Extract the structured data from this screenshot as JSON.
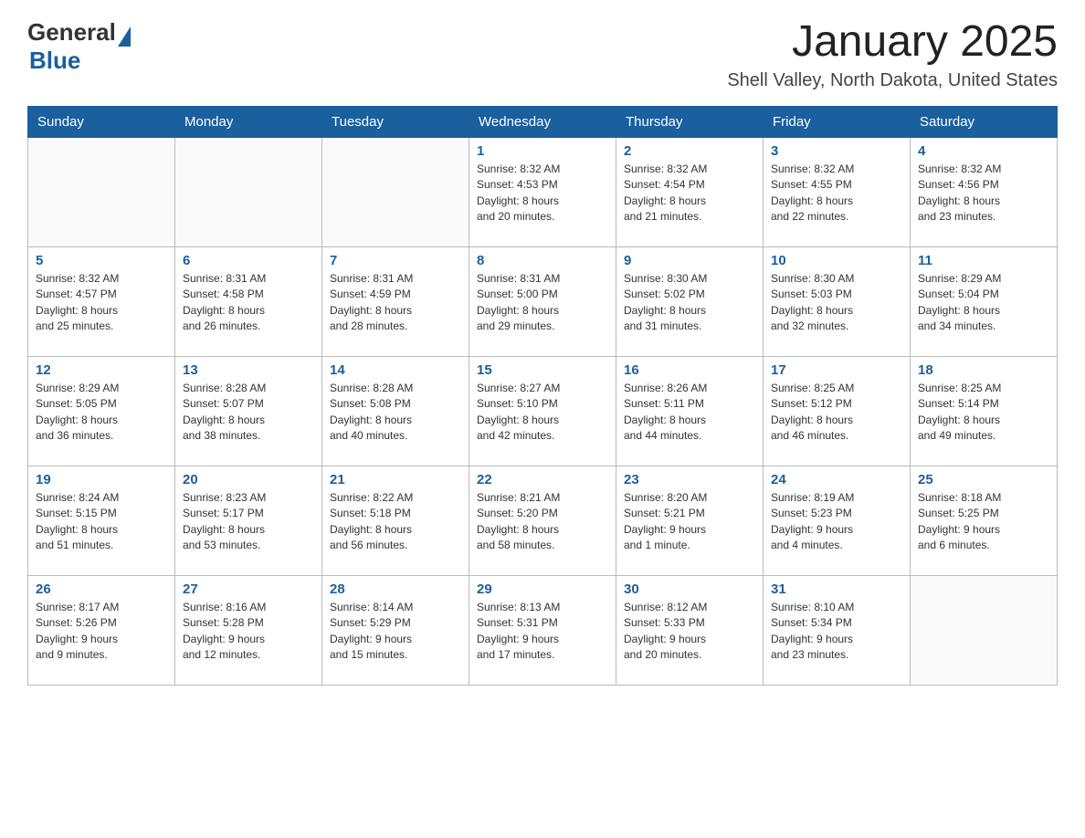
{
  "header": {
    "logo_general": "General",
    "logo_blue": "Blue",
    "month_title": "January 2025",
    "location": "Shell Valley, North Dakota, United States"
  },
  "days_of_week": [
    "Sunday",
    "Monday",
    "Tuesday",
    "Wednesday",
    "Thursday",
    "Friday",
    "Saturday"
  ],
  "weeks": [
    [
      {
        "num": "",
        "info": ""
      },
      {
        "num": "",
        "info": ""
      },
      {
        "num": "",
        "info": ""
      },
      {
        "num": "1",
        "info": "Sunrise: 8:32 AM\nSunset: 4:53 PM\nDaylight: 8 hours\nand 20 minutes."
      },
      {
        "num": "2",
        "info": "Sunrise: 8:32 AM\nSunset: 4:54 PM\nDaylight: 8 hours\nand 21 minutes."
      },
      {
        "num": "3",
        "info": "Sunrise: 8:32 AM\nSunset: 4:55 PM\nDaylight: 8 hours\nand 22 minutes."
      },
      {
        "num": "4",
        "info": "Sunrise: 8:32 AM\nSunset: 4:56 PM\nDaylight: 8 hours\nand 23 minutes."
      }
    ],
    [
      {
        "num": "5",
        "info": "Sunrise: 8:32 AM\nSunset: 4:57 PM\nDaylight: 8 hours\nand 25 minutes."
      },
      {
        "num": "6",
        "info": "Sunrise: 8:31 AM\nSunset: 4:58 PM\nDaylight: 8 hours\nand 26 minutes."
      },
      {
        "num": "7",
        "info": "Sunrise: 8:31 AM\nSunset: 4:59 PM\nDaylight: 8 hours\nand 28 minutes."
      },
      {
        "num": "8",
        "info": "Sunrise: 8:31 AM\nSunset: 5:00 PM\nDaylight: 8 hours\nand 29 minutes."
      },
      {
        "num": "9",
        "info": "Sunrise: 8:30 AM\nSunset: 5:02 PM\nDaylight: 8 hours\nand 31 minutes."
      },
      {
        "num": "10",
        "info": "Sunrise: 8:30 AM\nSunset: 5:03 PM\nDaylight: 8 hours\nand 32 minutes."
      },
      {
        "num": "11",
        "info": "Sunrise: 8:29 AM\nSunset: 5:04 PM\nDaylight: 8 hours\nand 34 minutes."
      }
    ],
    [
      {
        "num": "12",
        "info": "Sunrise: 8:29 AM\nSunset: 5:05 PM\nDaylight: 8 hours\nand 36 minutes."
      },
      {
        "num": "13",
        "info": "Sunrise: 8:28 AM\nSunset: 5:07 PM\nDaylight: 8 hours\nand 38 minutes."
      },
      {
        "num": "14",
        "info": "Sunrise: 8:28 AM\nSunset: 5:08 PM\nDaylight: 8 hours\nand 40 minutes."
      },
      {
        "num": "15",
        "info": "Sunrise: 8:27 AM\nSunset: 5:10 PM\nDaylight: 8 hours\nand 42 minutes."
      },
      {
        "num": "16",
        "info": "Sunrise: 8:26 AM\nSunset: 5:11 PM\nDaylight: 8 hours\nand 44 minutes."
      },
      {
        "num": "17",
        "info": "Sunrise: 8:25 AM\nSunset: 5:12 PM\nDaylight: 8 hours\nand 46 minutes."
      },
      {
        "num": "18",
        "info": "Sunrise: 8:25 AM\nSunset: 5:14 PM\nDaylight: 8 hours\nand 49 minutes."
      }
    ],
    [
      {
        "num": "19",
        "info": "Sunrise: 8:24 AM\nSunset: 5:15 PM\nDaylight: 8 hours\nand 51 minutes."
      },
      {
        "num": "20",
        "info": "Sunrise: 8:23 AM\nSunset: 5:17 PM\nDaylight: 8 hours\nand 53 minutes."
      },
      {
        "num": "21",
        "info": "Sunrise: 8:22 AM\nSunset: 5:18 PM\nDaylight: 8 hours\nand 56 minutes."
      },
      {
        "num": "22",
        "info": "Sunrise: 8:21 AM\nSunset: 5:20 PM\nDaylight: 8 hours\nand 58 minutes."
      },
      {
        "num": "23",
        "info": "Sunrise: 8:20 AM\nSunset: 5:21 PM\nDaylight: 9 hours\nand 1 minute."
      },
      {
        "num": "24",
        "info": "Sunrise: 8:19 AM\nSunset: 5:23 PM\nDaylight: 9 hours\nand 4 minutes."
      },
      {
        "num": "25",
        "info": "Sunrise: 8:18 AM\nSunset: 5:25 PM\nDaylight: 9 hours\nand 6 minutes."
      }
    ],
    [
      {
        "num": "26",
        "info": "Sunrise: 8:17 AM\nSunset: 5:26 PM\nDaylight: 9 hours\nand 9 minutes."
      },
      {
        "num": "27",
        "info": "Sunrise: 8:16 AM\nSunset: 5:28 PM\nDaylight: 9 hours\nand 12 minutes."
      },
      {
        "num": "28",
        "info": "Sunrise: 8:14 AM\nSunset: 5:29 PM\nDaylight: 9 hours\nand 15 minutes."
      },
      {
        "num": "29",
        "info": "Sunrise: 8:13 AM\nSunset: 5:31 PM\nDaylight: 9 hours\nand 17 minutes."
      },
      {
        "num": "30",
        "info": "Sunrise: 8:12 AM\nSunset: 5:33 PM\nDaylight: 9 hours\nand 20 minutes."
      },
      {
        "num": "31",
        "info": "Sunrise: 8:10 AM\nSunset: 5:34 PM\nDaylight: 9 hours\nand 23 minutes."
      },
      {
        "num": "",
        "info": ""
      }
    ]
  ]
}
